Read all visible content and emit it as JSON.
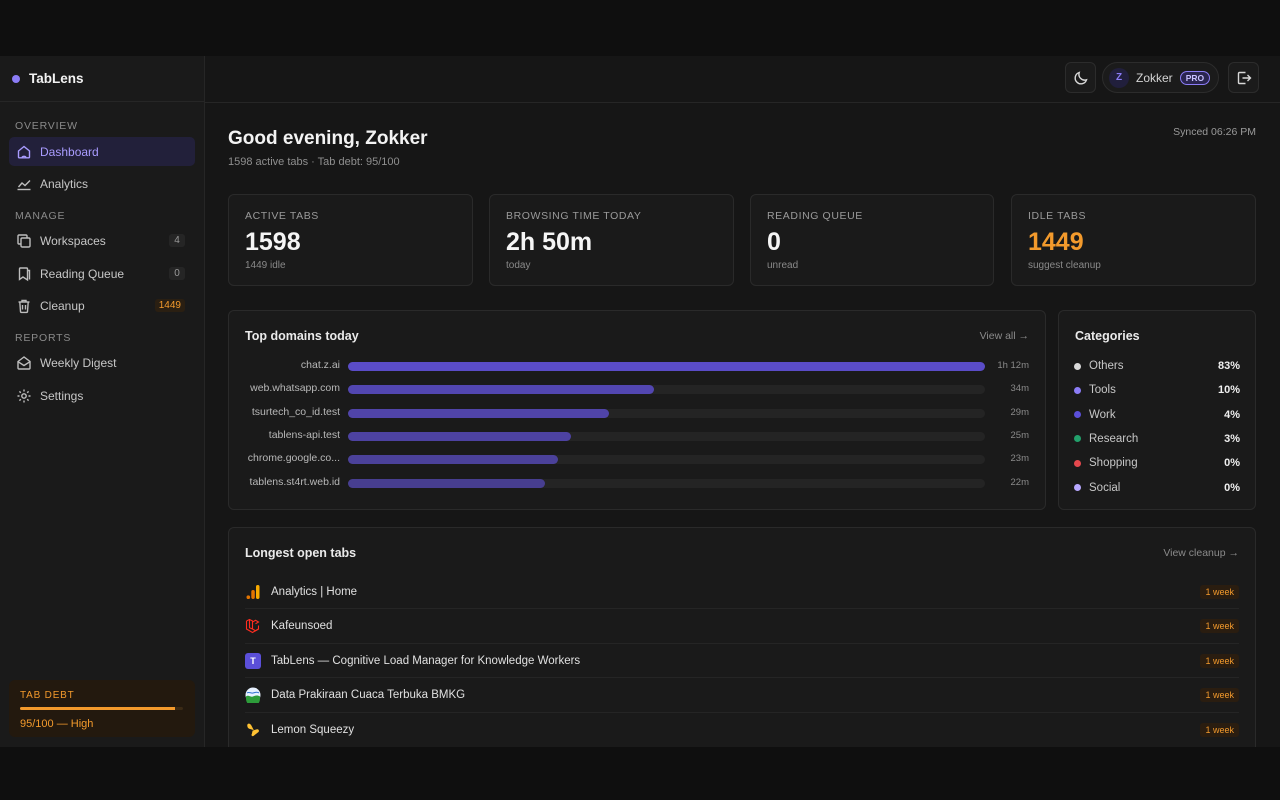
{
  "brand": {
    "name": "TabLens"
  },
  "nav": {
    "groups": {
      "overview": "OVERVIEW",
      "manage": "MANAGE",
      "reports": "REPORTS"
    },
    "items": [
      {
        "label": "Dashboard",
        "icon": "home-icon",
        "active": true
      },
      {
        "label": "Analytics",
        "icon": "line-chart-icon"
      },
      {
        "label": "Workspaces",
        "icon": "copy-icon",
        "count": "4"
      },
      {
        "label": "Reading Queue",
        "icon": "bookmark-icon",
        "count": "0"
      },
      {
        "label": "Cleanup",
        "icon": "trash-icon",
        "count": "1449"
      },
      {
        "label": "Weekly Digest",
        "icon": "mail-icon"
      },
      {
        "label": "Settings",
        "icon": "gear-icon"
      }
    ]
  },
  "tab_debt": {
    "title": "TAB DEBT",
    "value": "95/100 — High",
    "level": 0.95
  },
  "user": {
    "initial": "Z",
    "name": "Zokker",
    "badge": "PRO"
  },
  "header": {
    "greeting": "Good evening, Zokker",
    "subtitle": "1598 active tabs · Tab debt: 95/100",
    "synced": "Synced 06:26 PM"
  },
  "stats": [
    {
      "label": "ACTIVE TABS",
      "value": "1598",
      "note": "1449 idle"
    },
    {
      "label": "BROWSING TIME TODAY",
      "value": "2h 50m",
      "note": "today"
    },
    {
      "label": "READING QUEUE",
      "value": "0",
      "note": "unread"
    },
    {
      "label": "IDLE TABS",
      "value": "1449",
      "note": "suggest cleanup",
      "accent": "#f39a2c"
    }
  ],
  "domains": {
    "title": "Top domains today",
    "link": "View all →",
    "rows": [
      {
        "name": "chat.z.ai",
        "time": "1h 12m",
        "share": 1.0
      },
      {
        "name": "web.whatsapp.com",
        "time": "34m",
        "share": 0.48
      },
      {
        "name": "tsurtech_co_id.test",
        "time": "29m",
        "share": 0.41
      },
      {
        "name": "tablens-api.test",
        "time": "25m",
        "share": 0.35
      },
      {
        "name": "chrome.google.co...",
        "time": "23m",
        "share": 0.33
      },
      {
        "name": "tablens.st4rt.web.id",
        "time": "22m",
        "share": 0.31
      }
    ]
  },
  "categories": {
    "title": "Categories",
    "rows": [
      {
        "name": "Others",
        "pct": "83%",
        "color": "#d9d9d9"
      },
      {
        "name": "Tools",
        "pct": "10%",
        "color": "#8b7cf6"
      },
      {
        "name": "Work",
        "pct": "4%",
        "color": "#5b4fd9"
      },
      {
        "name": "Research",
        "pct": "3%",
        "color": "#22a06b"
      },
      {
        "name": "Shopping",
        "pct": "0%",
        "color": "#e5484d"
      },
      {
        "name": "Social",
        "pct": "0%",
        "color": "#b8a8ff"
      }
    ]
  },
  "longest": {
    "title": "Longest open tabs",
    "link": "View cleanup →",
    "rows": [
      {
        "title": "Analytics | Home",
        "age": "1 week",
        "icon": "google-analytics-icon"
      },
      {
        "title": "Kafeunsoed",
        "age": "1 week",
        "icon": "laravel-icon"
      },
      {
        "title": "TabLens — Cognitive Load Manager for Knowledge Workers",
        "age": "1 week",
        "icon": "tablens-icon",
        "icon_text": "T"
      },
      {
        "title": "Data Prakiraan Cuaca Terbuka BMKG",
        "age": "1 week",
        "icon": "bmkg-icon"
      },
      {
        "title": "Lemon Squeezy",
        "age": "1 week",
        "icon": "lemon-squeezy-icon"
      }
    ]
  },
  "colors": {
    "accent": "#8b7cf6",
    "warning": "#f39a2c",
    "bar": "#5a4cc7"
  }
}
